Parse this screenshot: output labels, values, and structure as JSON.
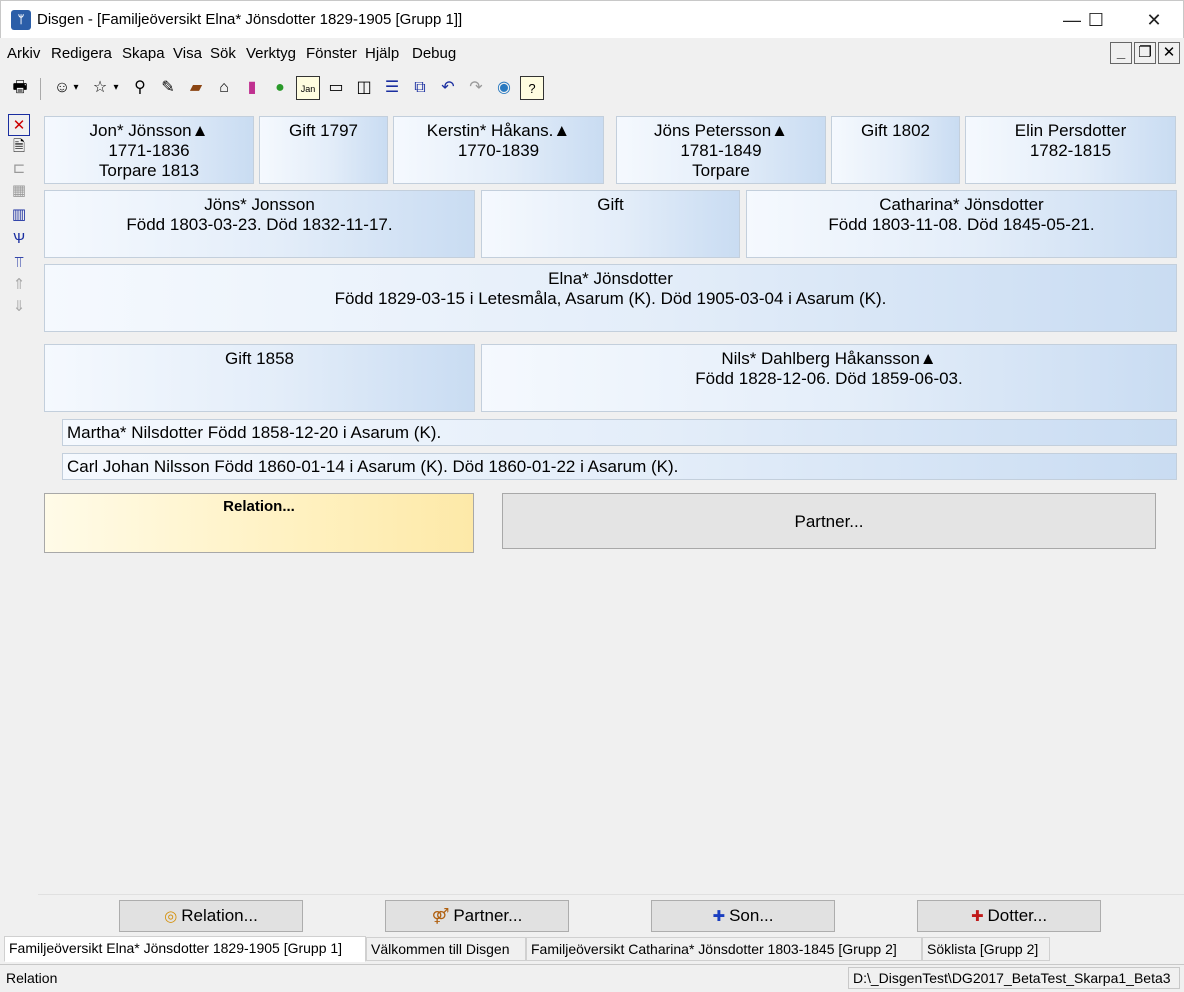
{
  "window": {
    "title": "Disgen - [Familjeöversikt Elna* Jönsdotter 1829-1905 [Grupp 1]]",
    "minimize": "—",
    "maximize": "☐",
    "close": "✕"
  },
  "menu": [
    "Arkiv",
    "Redigera",
    "Skapa",
    "Visa",
    "Sök",
    "Verktyg",
    "Fönster",
    "Hjälp",
    "Debug"
  ],
  "mdi": {
    "minimize": "_",
    "restore": "❐",
    "close": "✕"
  },
  "toolbar_icons": [
    "print-icon",
    "person-icon",
    "person-star-icon",
    "binoculars-icon",
    "note-edit-icon",
    "book-icon",
    "home-icon",
    "books-icon",
    "map-icon",
    "calendar-icon",
    "window-single-icon",
    "window-split-icon",
    "window-stack-icon",
    "window-cascade-icon",
    "undo-icon",
    "redo-icon",
    "globe-icon",
    "help-icon"
  ],
  "left_icons": [
    "delete-icon",
    "document-icon",
    "tree-icon",
    "grid-icon",
    "columns-icon",
    "pedigree-icon",
    "descendants-icon",
    "up-icon",
    "down-icon"
  ],
  "grandparents": [
    {
      "lines": [
        "Jon* Jönsson▲",
        "1771-1836",
        "Torpare  1813"
      ]
    },
    {
      "lines": [
        "Gift 1797"
      ]
    },
    {
      "lines": [
        "Kerstin* Håkans.▲",
        "1770-1839"
      ]
    },
    {
      "lines": [
        "Jöns Petersson▲",
        "1781-1849",
        "Torpare"
      ]
    },
    {
      "lines": [
        "Gift 1802"
      ]
    },
    {
      "lines": [
        "Elin Persdotter",
        "1782-1815"
      ]
    }
  ],
  "parents": [
    {
      "lines": [
        "Jöns* Jonsson",
        "Född 1803-03-23. Död 1832-11-17."
      ]
    },
    {
      "lines": [
        "Gift"
      ]
    },
    {
      "lines": [
        "Catharina* Jönsdotter",
        "Född 1803-11-08. Död 1845-05-21."
      ]
    }
  ],
  "main_person": {
    "lines": [
      "Elna* Jönsdotter",
      "Född 1829-03-15 i Letesmåla, Asarum (K). Död 1905-03-04 i Asarum (K)."
    ]
  },
  "marriage": {
    "lines": [
      "Gift 1858"
    ]
  },
  "spouse": {
    "lines": [
      "Nils* Dahlberg Håkansson▲",
      "Född 1828-12-06. Död 1859-06-03."
    ]
  },
  "children": [
    "Martha* Nilsdotter Född 1858-12-20 i Asarum (K).",
    "Carl Johan Nilsson Född 1860-01-14 i Asarum (K). Död 1860-01-22 i Asarum (K)."
  ],
  "relation_placeholder": "Relation...",
  "partner_placeholder": "Partner...",
  "buttons": {
    "relation": "Relation...",
    "partner": "Partner...",
    "son": "Son...",
    "daughter": "Dotter..."
  },
  "tabs": [
    "Familjeöversikt Elna* Jönsdotter 1829-1905 [Grupp 1]",
    "Välkommen till Disgen",
    "Familjeöversikt Catharina* Jönsdotter 1803-1845 [Grupp 2]",
    "Söklista [Grupp 2]"
  ],
  "status": {
    "left": "Relation",
    "right": "D:\\_DisgenTest\\DG2017_BetaTest_Skarpa1_Beta3"
  },
  "colors": {
    "cell_gradient_start": "#f5f9fe",
    "cell_gradient_end": "#c9dcf2",
    "relation_yellow": "#fff1c0"
  }
}
